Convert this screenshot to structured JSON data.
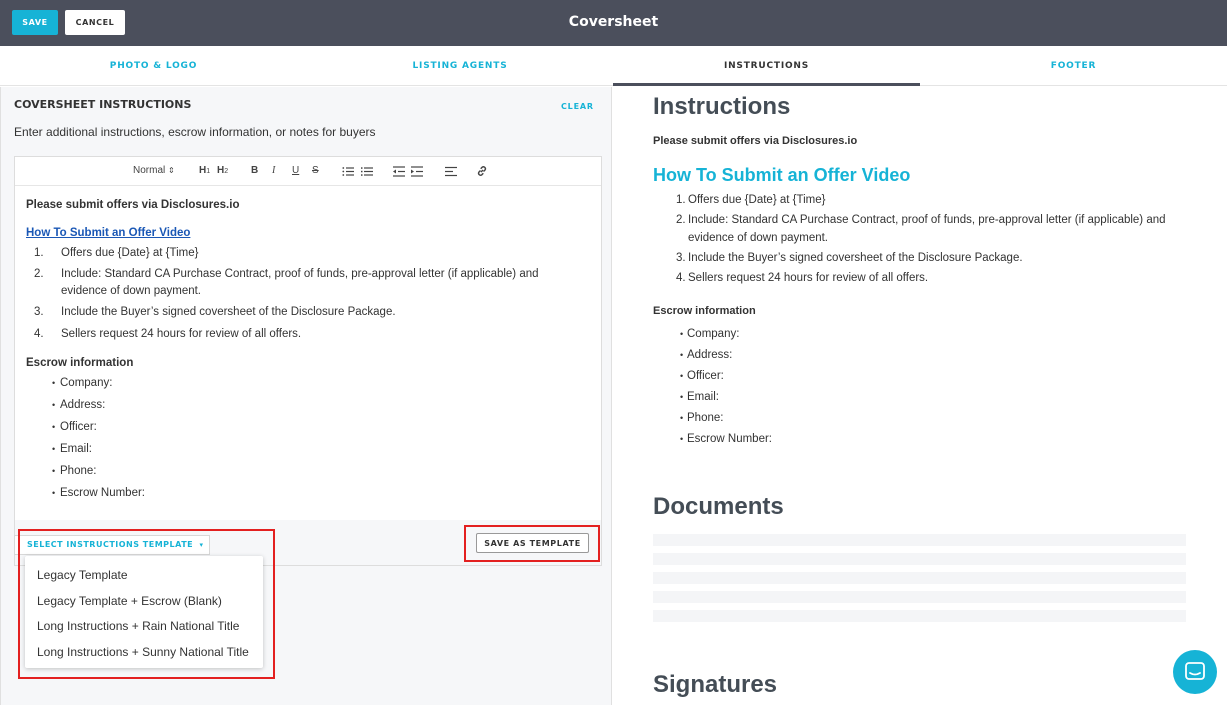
{
  "header": {
    "save_label": "SAVE",
    "cancel_label": "CANCEL",
    "title": "Coversheet",
    "colors": {
      "header_bg": "#4b4f5c",
      "accent": "#16b3d6"
    }
  },
  "tabs": [
    {
      "label": "PHOTO & LOGO",
      "active": false
    },
    {
      "label": "LISTING AGENTS",
      "active": false
    },
    {
      "label": "INSTRUCTIONS",
      "active": true
    },
    {
      "label": "FOOTER",
      "active": false
    }
  ],
  "left": {
    "section_title": "COVERSHEET INSTRUCTIONS",
    "clear_label": "CLEAR",
    "description": "Enter additional instructions, escrow information, or notes for buyers",
    "toolbar": {
      "format_select": "Normal",
      "h1": "H1",
      "h2": "H2",
      "bold": "B",
      "italic": "I",
      "underline": "U",
      "strike": "S"
    },
    "editor": {
      "intro": "Please submit offers via Disclosures.io",
      "link": "How To Submit an Offer Video",
      "steps": [
        "Offers due {Date} at {Time}",
        "Include: Standard CA Purchase Contract, proof of funds, pre-approval letter (if applicable) and evidence of down payment.",
        "Include the Buyer’s signed coversheet of the Disclosure Package.",
        "Sellers request 24 hours for review of all offers."
      ],
      "step_numbers": [
        "1.",
        "2.",
        "3.",
        "4."
      ],
      "escrow_heading": "Escrow information",
      "escrow_items": [
        "Company:",
        "Address:",
        "Officer:",
        "Email:",
        "Phone:",
        "Escrow Number:"
      ]
    },
    "select_template_label": "SELECT INSTRUCTIONS TEMPLATE",
    "save_template_label": "SAVE AS TEMPLATE",
    "dropdown_items": [
      "Legacy Template",
      "Legacy Template + Escrow (Blank)",
      "Long Instructions + Rain National Title",
      "Long Instructions + Sunny National Title"
    ]
  },
  "preview": {
    "heading": "Instructions",
    "intro": "Please submit offers via Disclosures.io",
    "subheading": "How To Submit an Offer Video",
    "steps": [
      "Offers due {Date} at {Time}",
      "Include: Standard CA Purchase Contract, proof of funds, pre-approval letter (if applicable) and evidence of down payment.",
      "Include the Buyer’s signed coversheet of the Disclosure Package.",
      "Sellers request 24 hours for review of all offers."
    ],
    "step_numbers": [
      "1.",
      "2.",
      "3.",
      "4."
    ],
    "escrow_heading": "Escrow information",
    "escrow_items": [
      "Company:",
      "Address:",
      "Officer:",
      "Email:",
      "Phone:",
      "Escrow Number:"
    ],
    "documents_heading": "Documents",
    "signatures_heading": "Signatures"
  },
  "icons": {
    "chat": "chat-bubble-icon",
    "dropdown_caret": "caret-down-icon"
  }
}
